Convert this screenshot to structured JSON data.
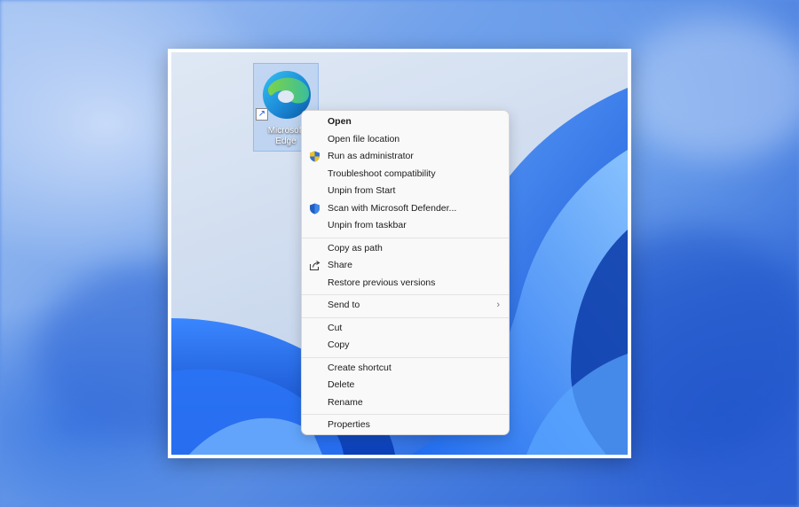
{
  "desktop": {
    "shortcut": {
      "label_line1": "Microsoft",
      "label_line2": "Edge",
      "arrow_glyph": "↗"
    }
  },
  "context_menu": {
    "groups": [
      [
        {
          "label": "Open",
          "bold": true,
          "icon": null
        },
        {
          "label": "Open file location",
          "icon": null
        },
        {
          "label": "Run as administrator",
          "icon": "uac-shield-icon"
        },
        {
          "label": "Troubleshoot compatibility",
          "icon": null
        },
        {
          "label": "Unpin from Start",
          "icon": null
        },
        {
          "label": "Scan with Microsoft Defender...",
          "icon": "defender-shield-icon"
        },
        {
          "label": "Unpin from taskbar",
          "icon": null
        }
      ],
      [
        {
          "label": "Copy as path",
          "icon": null
        },
        {
          "label": "Share",
          "icon": "share-icon"
        },
        {
          "label": "Restore previous versions",
          "icon": null
        }
      ],
      [
        {
          "label": "Send to",
          "icon": null,
          "submenu": true,
          "chevron": "›"
        }
      ],
      [
        {
          "label": "Cut",
          "icon": null
        },
        {
          "label": "Copy",
          "icon": null
        }
      ],
      [
        {
          "label": "Create shortcut",
          "icon": null
        },
        {
          "label": "Delete",
          "icon": null
        },
        {
          "label": "Rename",
          "icon": null
        }
      ],
      [
        {
          "label": "Properties",
          "icon": null
        }
      ]
    ]
  },
  "colors": {
    "accent": "#1a5fd6",
    "uac_yellow": "#f2c21b",
    "uac_blue": "#2f6fd8",
    "defender_blue": "#1f5fbf"
  }
}
